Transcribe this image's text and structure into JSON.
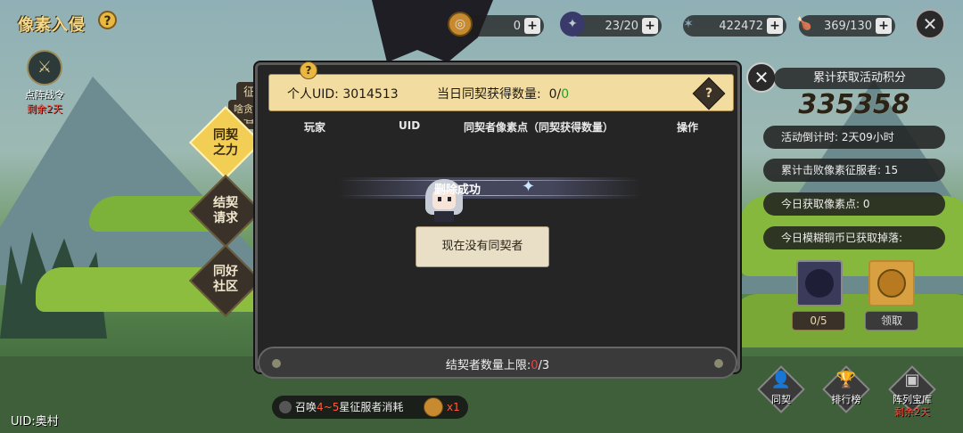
{
  "header": {
    "game_title": "像素入侵",
    "help": "?"
  },
  "resources": [
    {
      "icon": "coin-icon",
      "value": "0"
    },
    {
      "icon": "crystal-icon",
      "value": "23/20"
    },
    {
      "icon": "star-icon",
      "value": "422472"
    },
    {
      "icon": "drumstick-icon",
      "value": "369/130"
    }
  ],
  "battle_order": {
    "label": "点阵战令",
    "remaining": "剩余2天"
  },
  "side_tabs": [
    {
      "label": "同契之力",
      "line1": "同契",
      "line2": "之力",
      "active": true
    },
    {
      "label": "结契请求",
      "line1": "结契",
      "line2": "请求",
      "active": false
    },
    {
      "label": "同好社区",
      "line1": "同好",
      "line2": "社区",
      "active": false
    }
  ],
  "side_vertical_text": "征服者",
  "side_top_text": "啥贪",
  "modal": {
    "uid_label": "个人UID: 3014513",
    "daily_label": "当日同契获得数量:",
    "daily_value_a": "0/",
    "daily_value_b": "0",
    "help": "?",
    "columns": [
      "玩家",
      "UID",
      "同契者像素点（同契获得数量）",
      "操作"
    ],
    "toast": "删除成功",
    "empty_message": "现在没有同契者",
    "footer_prefix": "结契者数量上限:",
    "footer_current": "0",
    "footer_suffix": "/3"
  },
  "right_panel": {
    "title": "累计获取活动积分",
    "score": "335358",
    "rows": [
      "活动倒计时: 2天09小时",
      "累计击败像素征服者: 15",
      "今日获取像素点: 0",
      "今日模糊铜币已获取掉落:"
    ],
    "item_count": "0/5",
    "claim_label": "领取"
  },
  "bottom_buttons": [
    {
      "label": "同契",
      "sub": ""
    },
    {
      "label": "排行榜",
      "sub": ""
    },
    {
      "label": "阵列宝库",
      "sub": "剩余2天"
    }
  ],
  "summon": {
    "prefix": "召唤",
    "range": "4~5",
    "suffix": "星征服者消耗",
    "multiplier": "x1"
  },
  "footer_uid": "UID:奥村",
  "colors": {
    "accent_gold": "#f2cf54",
    "header_bg": "#f2dca0",
    "modal_bg": "#252525",
    "green": "#2aa02a",
    "red": "#ff3a3a"
  }
}
